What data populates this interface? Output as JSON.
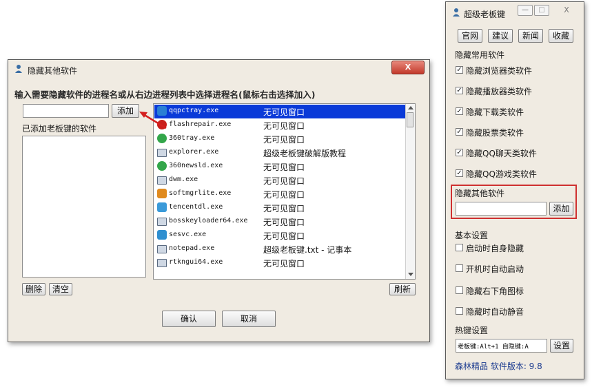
{
  "dialog": {
    "title": "隐藏其他软件",
    "instruction": "输入需要隐藏软件的进程名或从右边进程列表中选择进程名(鼠标右击选择加入)",
    "name_input_value": "",
    "add_button": "添加",
    "added_list_label": "已添加老板键的软件",
    "delete_button": "删除",
    "clear_button": "清空",
    "refresh_button": "刷新",
    "ok_button": "确认",
    "cancel_button": "取消",
    "close_glyph": "X",
    "processes": [
      {
        "name": "qqpctray.exe",
        "title": "无可见窗口",
        "icon": "shield-icon",
        "color": "#2a7fd4",
        "selected": true
      },
      {
        "name": "flashrepair.exe",
        "title": "无可见窗口",
        "icon": "flash-icon",
        "color": "#c8201c",
        "selected": false
      },
      {
        "name": "360tray.exe",
        "title": "无可见窗口",
        "icon": "360-icon",
        "color": "#33a64a",
        "selected": false
      },
      {
        "name": "explorer.exe",
        "title": "超级老板键破解版教程",
        "icon": "window-icon",
        "color": "#7a8aa0",
        "selected": false
      },
      {
        "name": "360newsld.exe",
        "title": "无可见窗口",
        "icon": "360-icon",
        "color": "#33a64a",
        "selected": false
      },
      {
        "name": "dwm.exe",
        "title": "无可见窗口",
        "icon": "window-icon",
        "color": "#7a8aa0",
        "selected": false
      },
      {
        "name": "softmgrlite.exe",
        "title": "无可见窗口",
        "icon": "puzzle-icon",
        "color": "#e08a1e",
        "selected": false
      },
      {
        "name": "tencentdl.exe",
        "title": "无可见窗口",
        "icon": "download-icon",
        "color": "#3a9ad9",
        "selected": false
      },
      {
        "name": "bosskeyloader64.exe",
        "title": "无可见窗口",
        "icon": "window-icon",
        "color": "#7a8aa0",
        "selected": false
      },
      {
        "name": "sesvc.exe",
        "title": "无可见窗口",
        "icon": "service-icon",
        "color": "#2f8fd0",
        "selected": false
      },
      {
        "name": "notepad.exe",
        "title": "超级老板键.txt - 记事本",
        "icon": "window-icon",
        "color": "#7a8aa0",
        "selected": false
      },
      {
        "name": "rtkngui64.exe",
        "title": "无可见窗口",
        "icon": "window-icon",
        "color": "#7a8aa0",
        "selected": false
      }
    ]
  },
  "main": {
    "title": "超级老板键",
    "window_buttons": {
      "minimize": "—",
      "maximize": "□",
      "close": "X"
    },
    "top_buttons": [
      "官网",
      "建议",
      "新闻",
      "收藏"
    ],
    "hide_common_label": "隐藏常用软件",
    "hide_common_items": [
      {
        "label": "隐藏浏览器类软件",
        "checked": true
      },
      {
        "label": "隐藏播放器类软件",
        "checked": true
      },
      {
        "label": "隐藏下载类软件",
        "checked": true
      },
      {
        "label": "隐藏股票类软件",
        "checked": true
      },
      {
        "label": "隐藏QQ聊天类软件",
        "checked": true
      },
      {
        "label": "隐藏QQ游戏类软件",
        "checked": true
      }
    ],
    "hide_other_label": "隐藏其他软件",
    "hide_other_value": "",
    "hide_other_add": "添加",
    "basic_label": "基本设置",
    "basic_items": [
      {
        "label": "启动时自身隐藏",
        "checked": false
      },
      {
        "label": "开机时自动启动",
        "checked": false
      },
      {
        "label": "隐藏右下角图标",
        "checked": false
      },
      {
        "label": "隐藏时自动静音",
        "checked": false
      }
    ],
    "hotkey_label": "热键设置",
    "hotkey_value": "老板键:Alt+1 自隐键:A",
    "hotkey_button": "设置",
    "footer": "森林精品 软件版本: 9.8"
  },
  "colors": {
    "selection": "#0a3ad8",
    "highlight_border": "#cf3030",
    "arrow": "#d42020",
    "close_red": "#d0473a",
    "link_blue": "#1a3a8f"
  }
}
